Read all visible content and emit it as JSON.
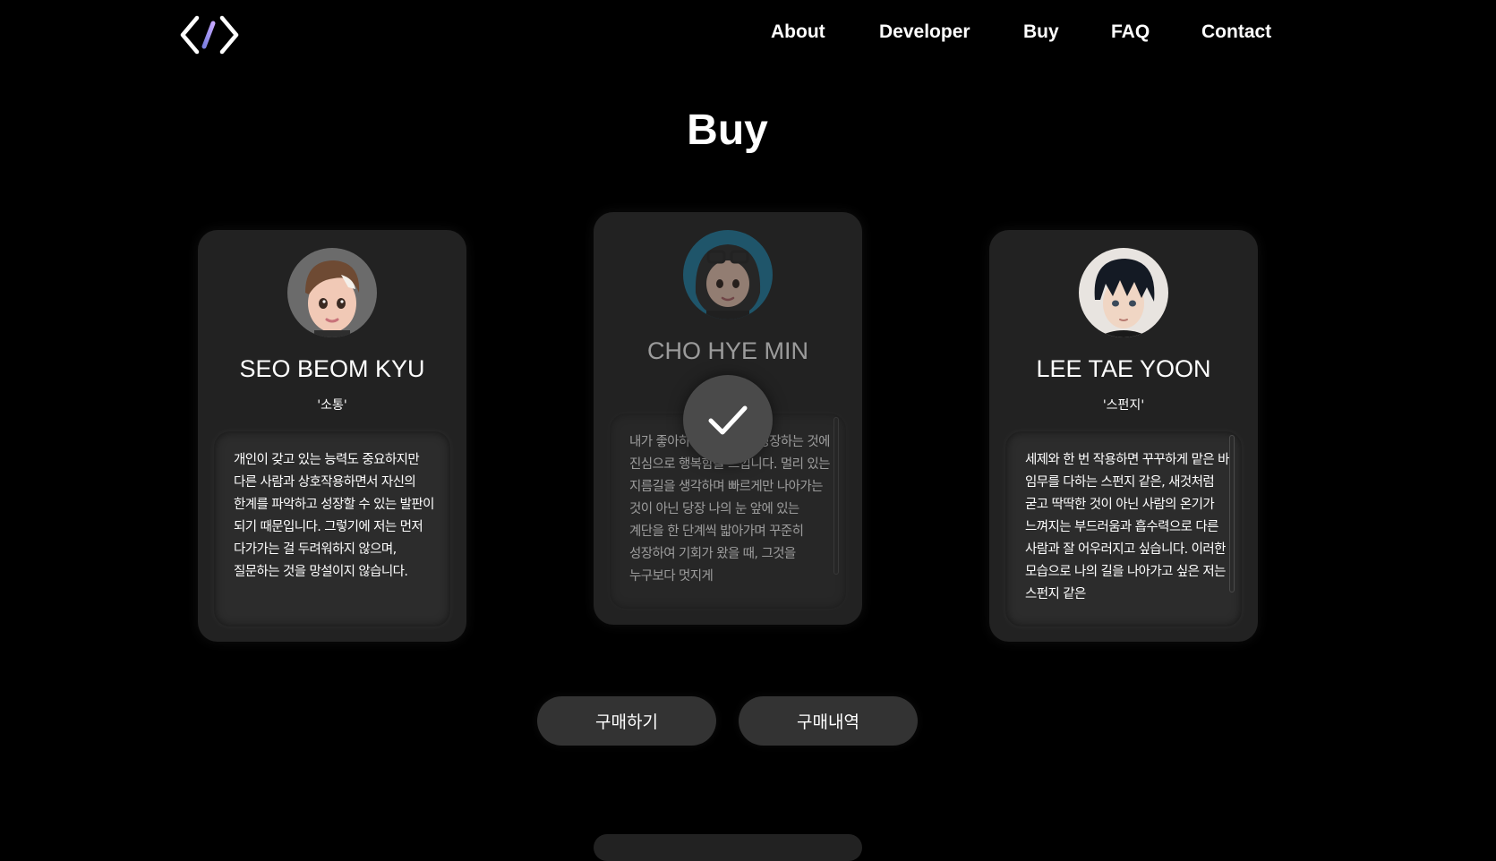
{
  "nav": {
    "logo_icon": "code-brackets-icon",
    "items": [
      "About",
      "Developer",
      "Buy",
      "FAQ",
      "Contact"
    ]
  },
  "page": {
    "title": "Buy"
  },
  "cards": [
    {
      "name": "SEO BEOM KYU",
      "nickname": "'소통'",
      "description": "개인이 갖고 있는 능력도 중요하지만 다른 사람과 상호작용하면서 자신의 한계를 파악하고 성장할 수 있는 발판이 되기 때문입니다. 그렇기에 저는 먼저 다가가는 걸 두려워하지 않으며, 질문하는 것을 망설이지 않습니다.",
      "selected": false
    },
    {
      "name": "CHO HYE MIN",
      "nickname": "",
      "description": "내가 좋아하는 일을 하며 성장하는 것에 진심으로 행복함을 느낍니다. 멀리 있는 지름길을 생각하며 빠르게만 나아가는 것이 아닌 당장 나의 눈 앞에 있는 계단을 한 단계씩 밟아가며 꾸준히 성장하여 기회가 왔을 때, 그것을 누구보다 멋지게",
      "selected": true,
      "selected_icon": "checkmark-icon"
    },
    {
      "name": "LEE TAE YOON",
      "nickname": "'스펀지'",
      "description": "세제와 한 번 작용하면 꾸꾸하게 맡은 바 임무를 다하는 스펀지 같은, 새것처럼 굳고 딱딱한 것이 아닌 사람의 온기가 느껴지는 부드러움과 흡수력으로 다른 사람과 잘 어우러지고 싶습니다. 이러한 모습으로 나의 길을 나아가고 싶은 저는 스펀지 같은",
      "selected": false
    }
  ],
  "buttons": {
    "buy": "구매하기",
    "history": "구매내역"
  },
  "colors": {
    "background": "#000000",
    "card": "#222222",
    "button": "#333333",
    "text": "#ffffff"
  }
}
